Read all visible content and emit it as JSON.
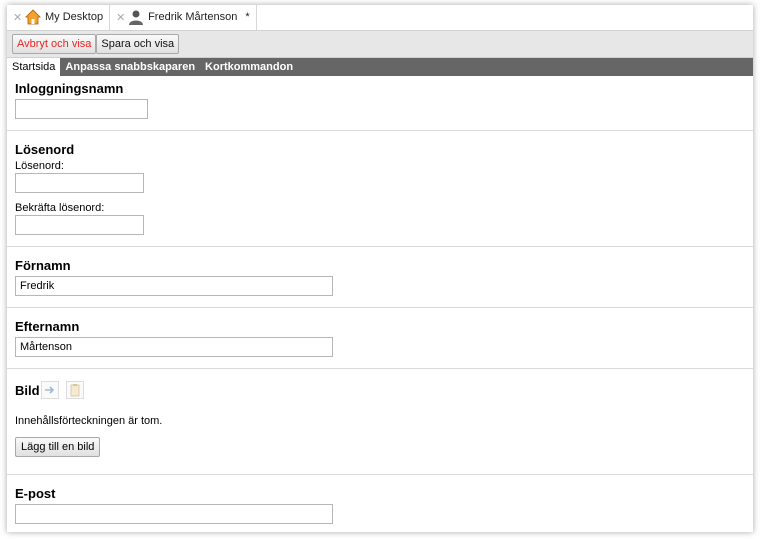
{
  "tabs": [
    {
      "label": "My Desktop",
      "icon": "home-icon",
      "modified": ""
    },
    {
      "label": "Fredrik Mårtenson",
      "icon": "user-icon",
      "modified": "*"
    }
  ],
  "toolbar": {
    "cancel_label": "Avbryt och visa",
    "save_label": "Spara och visa"
  },
  "section_tabs": [
    "Startsida",
    "Anpassa snabbskaparen",
    "Kortkommandon"
  ],
  "form": {
    "login": {
      "heading": "Inloggningsnamn",
      "value": ""
    },
    "password": {
      "heading": "Lösenord",
      "label1": "Lösenord:",
      "label2": "Bekräfta lösenord:",
      "value1": "",
      "value2": ""
    },
    "firstname": {
      "heading": "Förnamn",
      "value": "Fredrik"
    },
    "lastname": {
      "heading": "Efternamn",
      "value": "Mårtenson"
    },
    "image": {
      "heading": "Bild",
      "empty_text": "Innehållsförteckningen är tom.",
      "add_label": "Lägg till en bild"
    },
    "email": {
      "heading": "E-post",
      "value": ""
    }
  },
  "colors": {
    "cancel_text": "#ee2222",
    "section_bar": "#666666"
  }
}
